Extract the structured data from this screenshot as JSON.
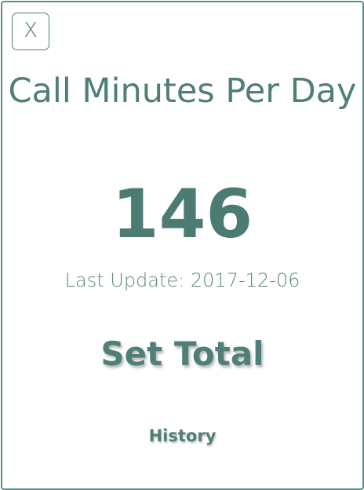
{
  "dialog": {
    "close_label": "X",
    "title": "Call Minutes Per Day",
    "value": "146",
    "last_update": "Last Update: 2017-12-06",
    "set_total_label": "Set Total",
    "history_label": "History"
  },
  "colors": {
    "accent": "#4f7f77",
    "border": "#5f8f87",
    "background": "#ffffff"
  },
  "icons": {
    "close": "close-icon"
  }
}
